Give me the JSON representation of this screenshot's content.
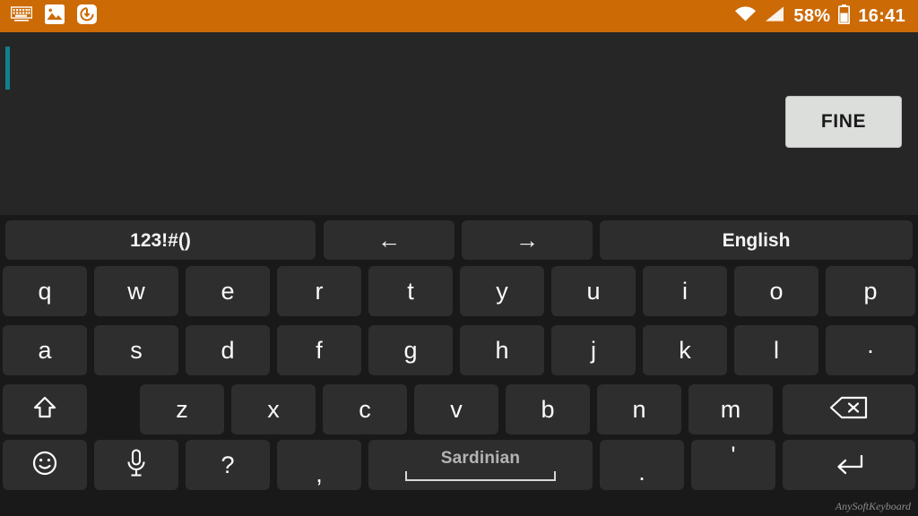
{
  "statusbar": {
    "background": "#cc6a06",
    "left_icons": [
      {
        "name": "keyboard-icon"
      },
      {
        "name": "image-icon"
      },
      {
        "name": "download-circle-icon"
      }
    ],
    "right_icons": [
      {
        "name": "wifi-icon"
      },
      {
        "name": "signal-icon"
      },
      {
        "name": "battery-icon"
      }
    ],
    "battery_percent": "58%",
    "clock": "16:41"
  },
  "editor": {
    "text_value": "",
    "caret_color": "#12808c",
    "underline_color": "#1f7f8c",
    "action_button": "FINE"
  },
  "keyboard": {
    "app_watermark": "AnySoftKeyboard",
    "key_background": "#2e2e2e",
    "board_background": "#191919",
    "function_row": [
      {
        "name": "symbols-key",
        "label": "123!#()"
      },
      {
        "name": "arrow-left-key",
        "label": "←"
      },
      {
        "name": "arrow-right-key",
        "label": "→"
      },
      {
        "name": "language-key",
        "label": "English"
      }
    ],
    "row1": [
      "q",
      "w",
      "e",
      "r",
      "t",
      "y",
      "u",
      "i",
      "o",
      "p"
    ],
    "row2": [
      "a",
      "s",
      "d",
      "f",
      "g",
      "h",
      "j",
      "k",
      "l",
      "·"
    ],
    "row3": [
      "z",
      "x",
      "c",
      "v",
      "b",
      "n",
      "m"
    ],
    "shift_key": {
      "name": "shift-key",
      "label": "⇧"
    },
    "backspace_key": {
      "name": "backspace-key",
      "label": "⌫"
    },
    "row4": [
      {
        "name": "emoji-key",
        "label": "☺"
      },
      {
        "name": "microphone-key",
        "label": "🎤"
      },
      {
        "name": "question-key",
        "label": "?"
      },
      {
        "name": "comma-key",
        "label": ","
      },
      {
        "name": "space-key",
        "label": "Sardinian"
      },
      {
        "name": "period-key",
        "label": "."
      },
      {
        "name": "apostrophe-key",
        "label": "'"
      },
      {
        "name": "enter-key",
        "label": "↵"
      }
    ]
  }
}
